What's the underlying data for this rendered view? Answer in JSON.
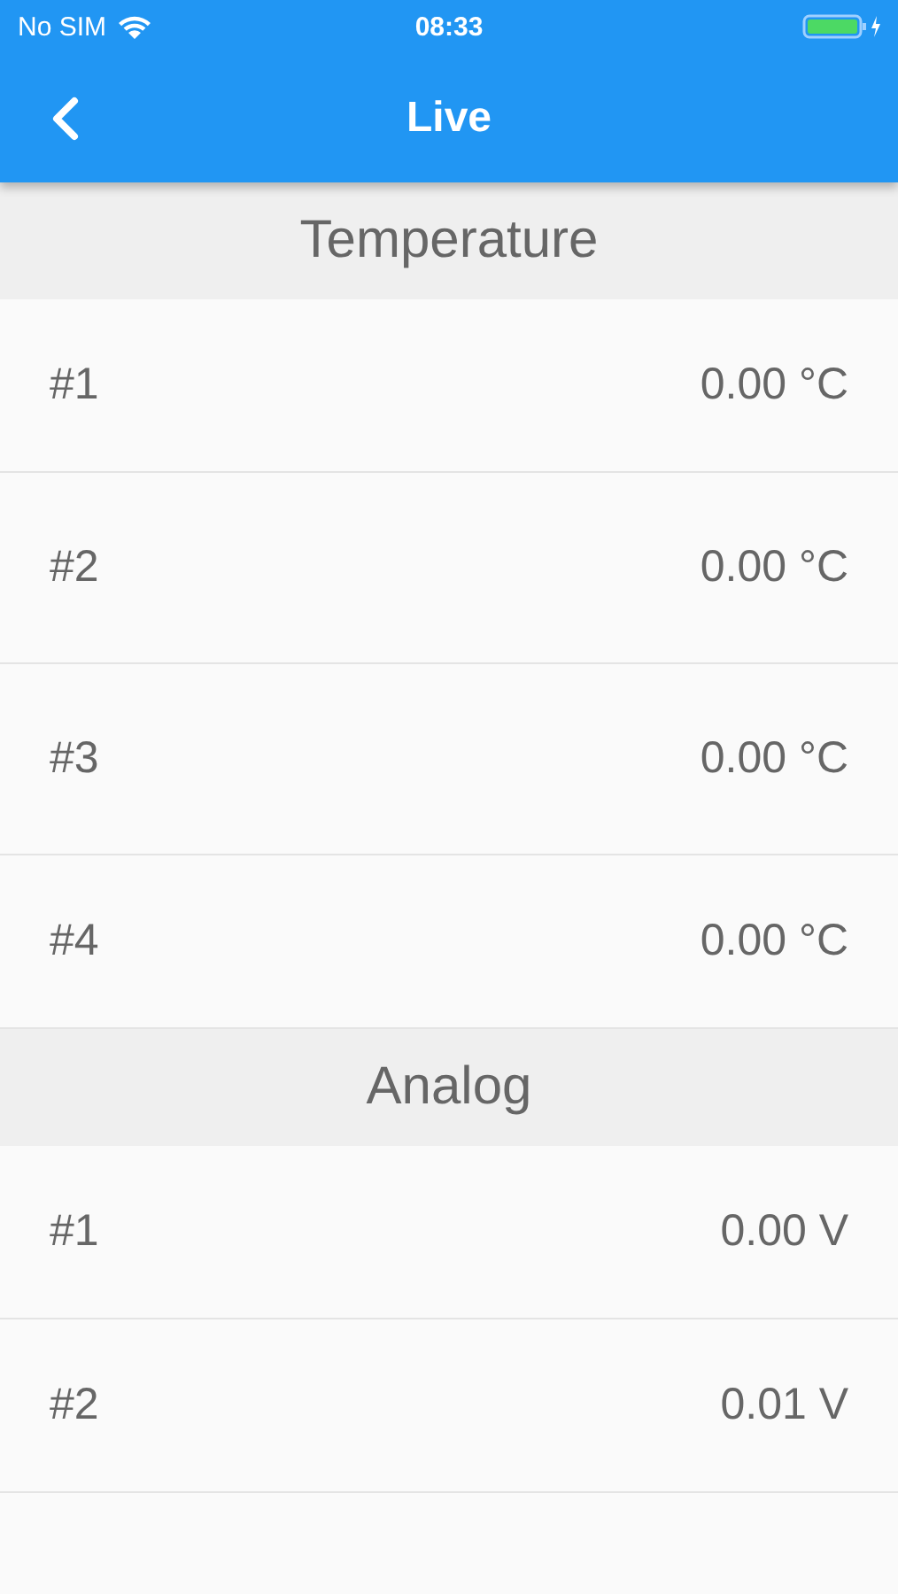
{
  "status_bar": {
    "carrier": "No SIM",
    "time": "08:33"
  },
  "nav_bar": {
    "title": "Live"
  },
  "sections": [
    {
      "title": "Temperature",
      "rows": [
        {
          "label": "#1",
          "value": "0.00 °C"
        },
        {
          "label": "#2",
          "value": "0.00 °C"
        },
        {
          "label": "#3",
          "value": "0.00 °C"
        },
        {
          "label": "#4",
          "value": "0.00 °C"
        }
      ]
    },
    {
      "title": "Analog",
      "rows": [
        {
          "label": "#1",
          "value": "0.00 V"
        },
        {
          "label": "#2",
          "value": "0.01 V"
        }
      ]
    }
  ]
}
